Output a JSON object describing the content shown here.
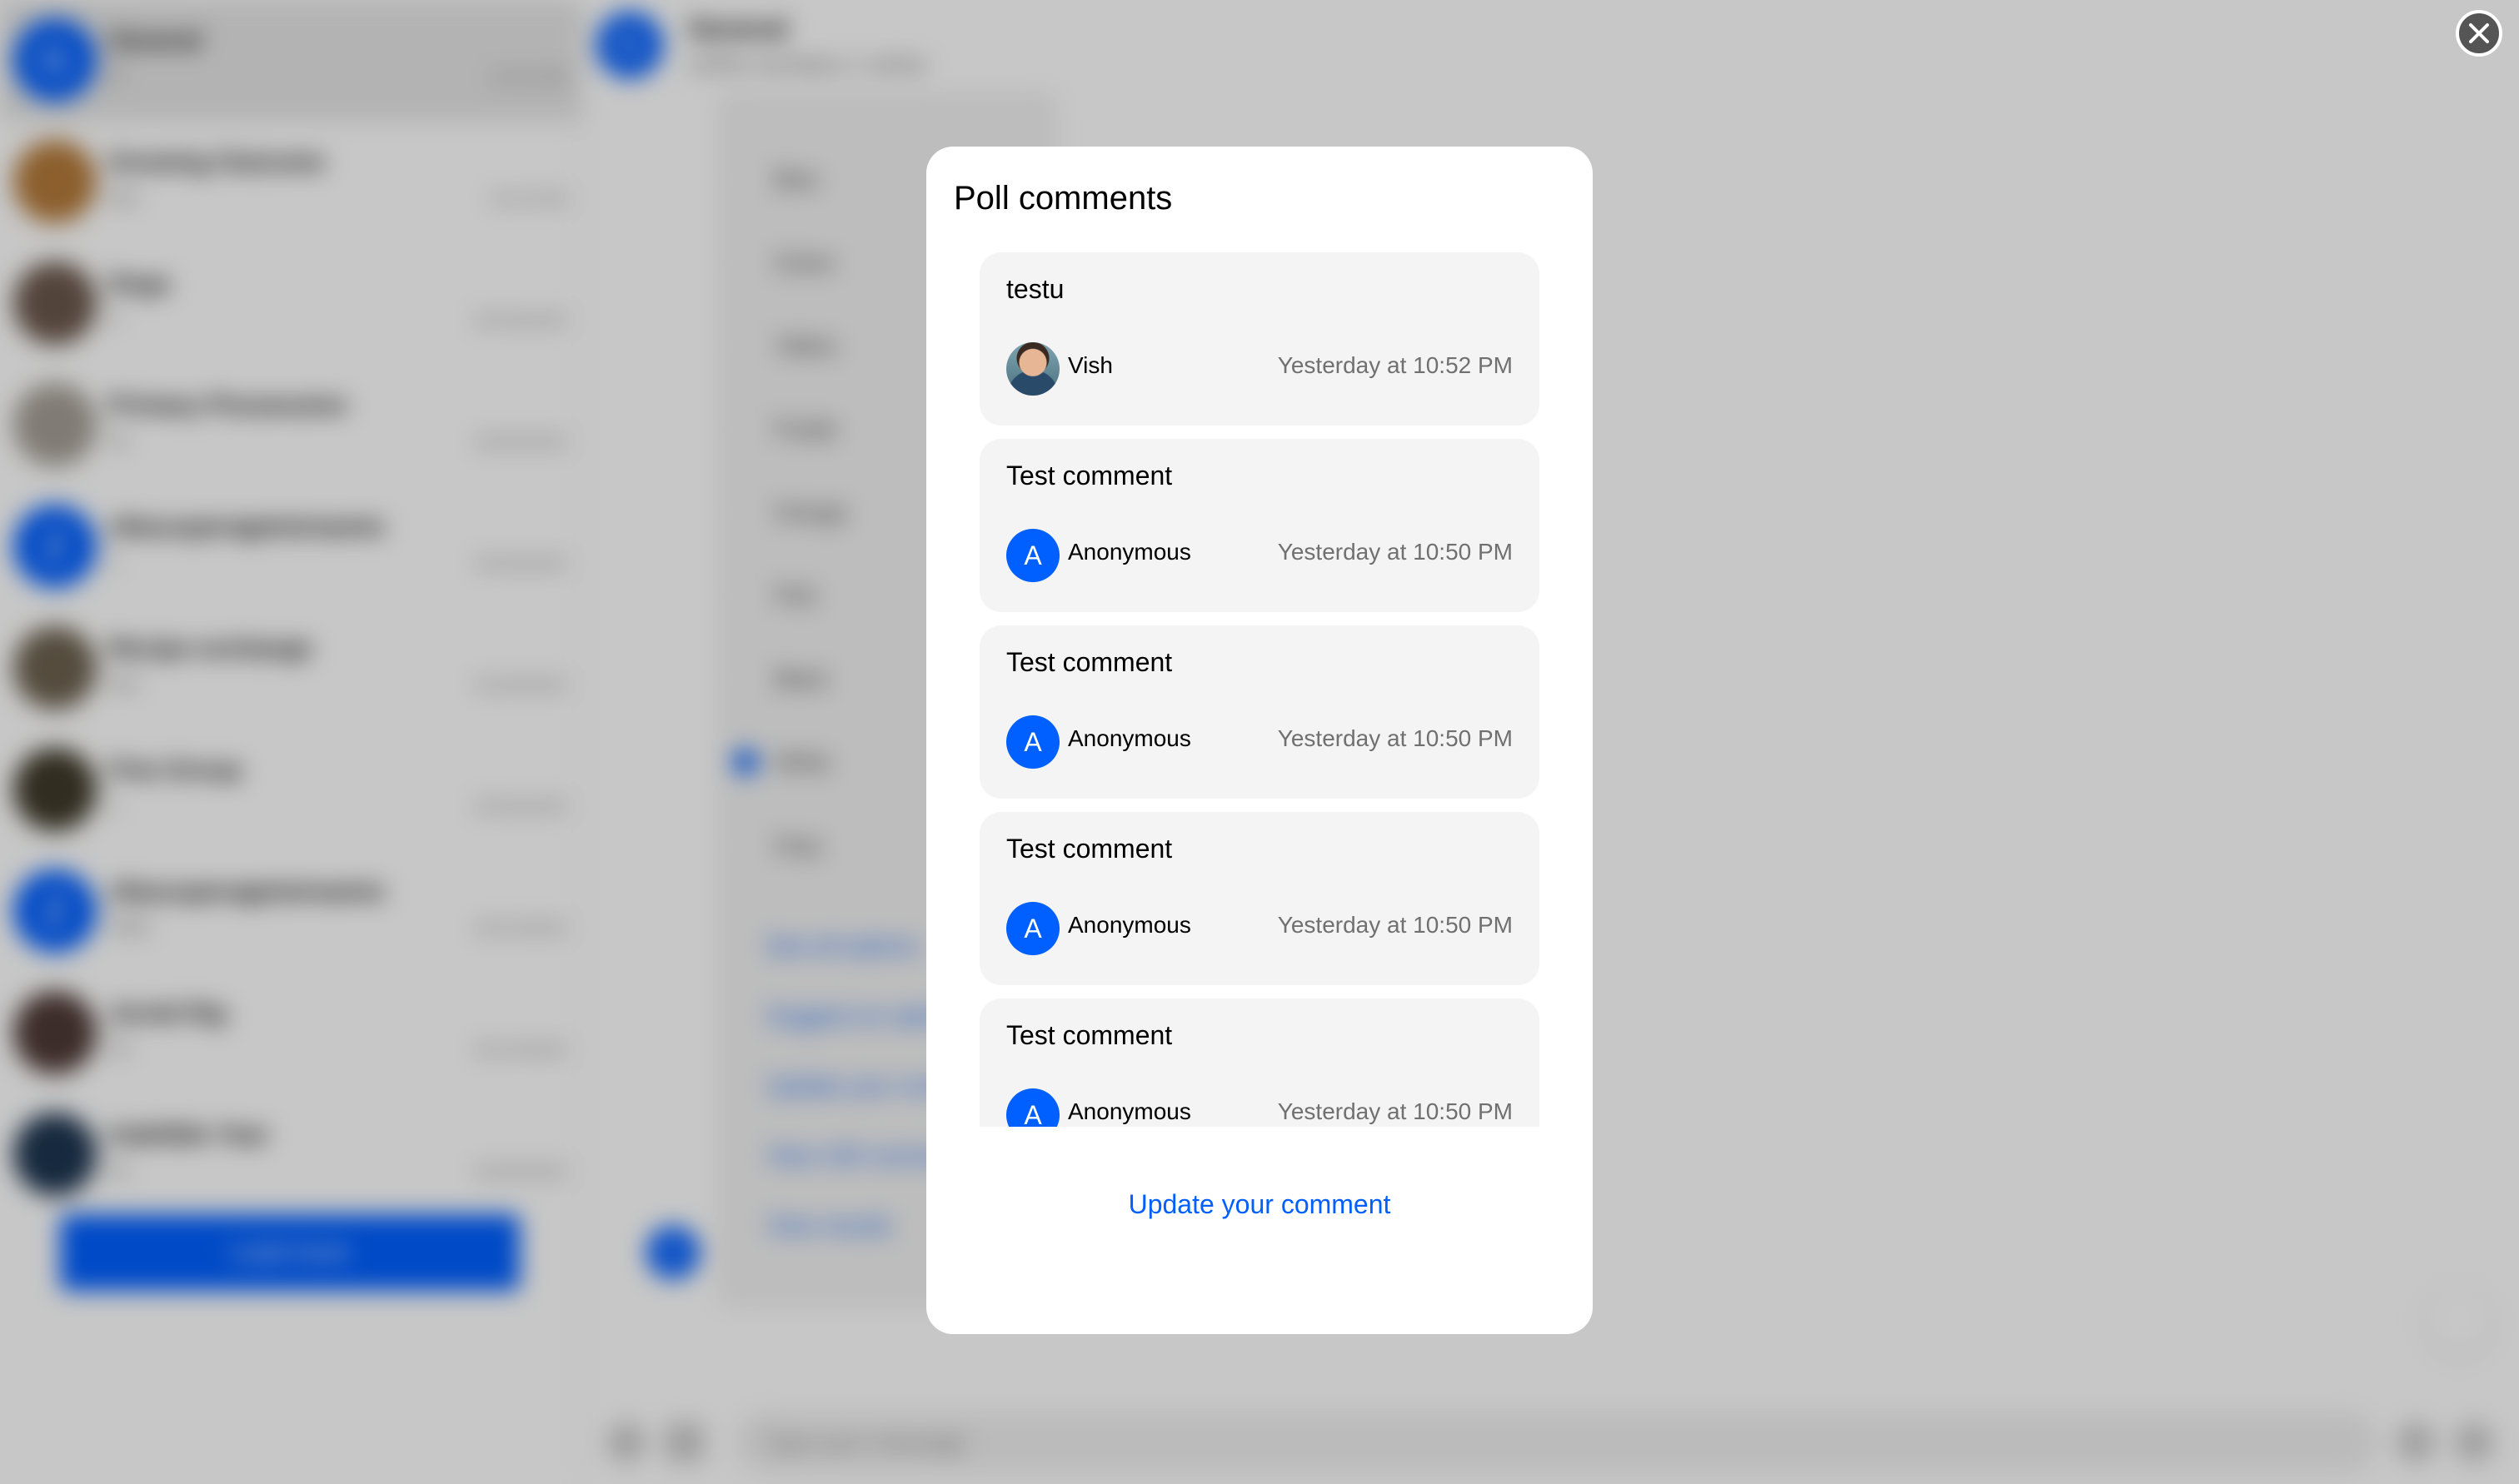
{
  "sidebar": {
    "chats": [
      {
        "title": "General",
        "preview": "hi",
        "time": "10:43 AM",
        "avatar_letter": "G"
      },
      {
        "title": "Growing Outcome",
        "preview": "test",
        "time": "10:43 AM",
        "avatar_letter": ""
      },
      {
        "title": "Dogs",
        "preview": "4",
        "time": "04/16/2025",
        "avatar_letter": ""
      },
      {
        "title": "Primary Possession",
        "preview": "ok",
        "time": "03/25/2025",
        "avatar_letter": ""
      },
      {
        "title": "zllaszuperagetstreamio",
        "preview": "1",
        "time": "03/18/2025",
        "avatar_letter": "Z"
      },
      {
        "title": "Recipe exchange",
        "preview": "test",
        "time": "03/18/2025",
        "avatar_letter": ""
      },
      {
        "title": "Fine Group",
        "preview": "1",
        "time": "03/18/2025",
        "avatar_letter": ""
      },
      {
        "title": "zllaszuperagetstreamio",
        "preview": "Hello",
        "time": "03/13/2025",
        "avatar_letter": "Z"
      },
      {
        "title": "Jovial Dig",
        "preview": "20",
        "time": "02/14/2025",
        "avatar_letter": ""
      },
      {
        "title": "Indelible Year",
        "preview": "ok",
        "time": "02/03/2025",
        "avatar_letter": ""
      }
    ],
    "load_more_label": "Load more"
  },
  "channel": {
    "title": "General",
    "subtitle": "10454 members 1 online",
    "avatar_letter": "G"
  },
  "poll": {
    "options": [
      "Blue",
      "Green",
      "Yellow",
      "Purple",
      "Orange",
      "Pink",
      "Black",
      "White",
      "Gray"
    ],
    "selected": "White",
    "links": [
      "See all options",
      "Suggest an option",
      "Update your comment",
      "View 100 comments",
      "View results"
    ],
    "sender_avatar_letter": "Z"
  },
  "composer": {
    "placeholder": "Type your message"
  },
  "modal": {
    "title": "Poll comments",
    "comments": [
      {
        "text": "testu",
        "user": "Vish",
        "time": "Yesterday at 10:52 PM",
        "avatar_letter": ""
      },
      {
        "text": "Test comment",
        "user": "Anonymous",
        "time": "Yesterday at 10:50 PM",
        "avatar_letter": "A"
      },
      {
        "text": "Test comment",
        "user": "Anonymous",
        "time": "Yesterday at 10:50 PM",
        "avatar_letter": "A"
      },
      {
        "text": "Test comment",
        "user": "Anonymous",
        "time": "Yesterday at 10:50 PM",
        "avatar_letter": "A"
      },
      {
        "text": "Test comment",
        "user": "Anonymous",
        "time": "Yesterday at 10:50 PM",
        "avatar_letter": "A"
      }
    ],
    "update_label": "Update your comment",
    "close_icon": "close-icon"
  },
  "colors": {
    "accent": "#005fff",
    "card": "#f4f4f4",
    "muted_text": "#707070"
  }
}
